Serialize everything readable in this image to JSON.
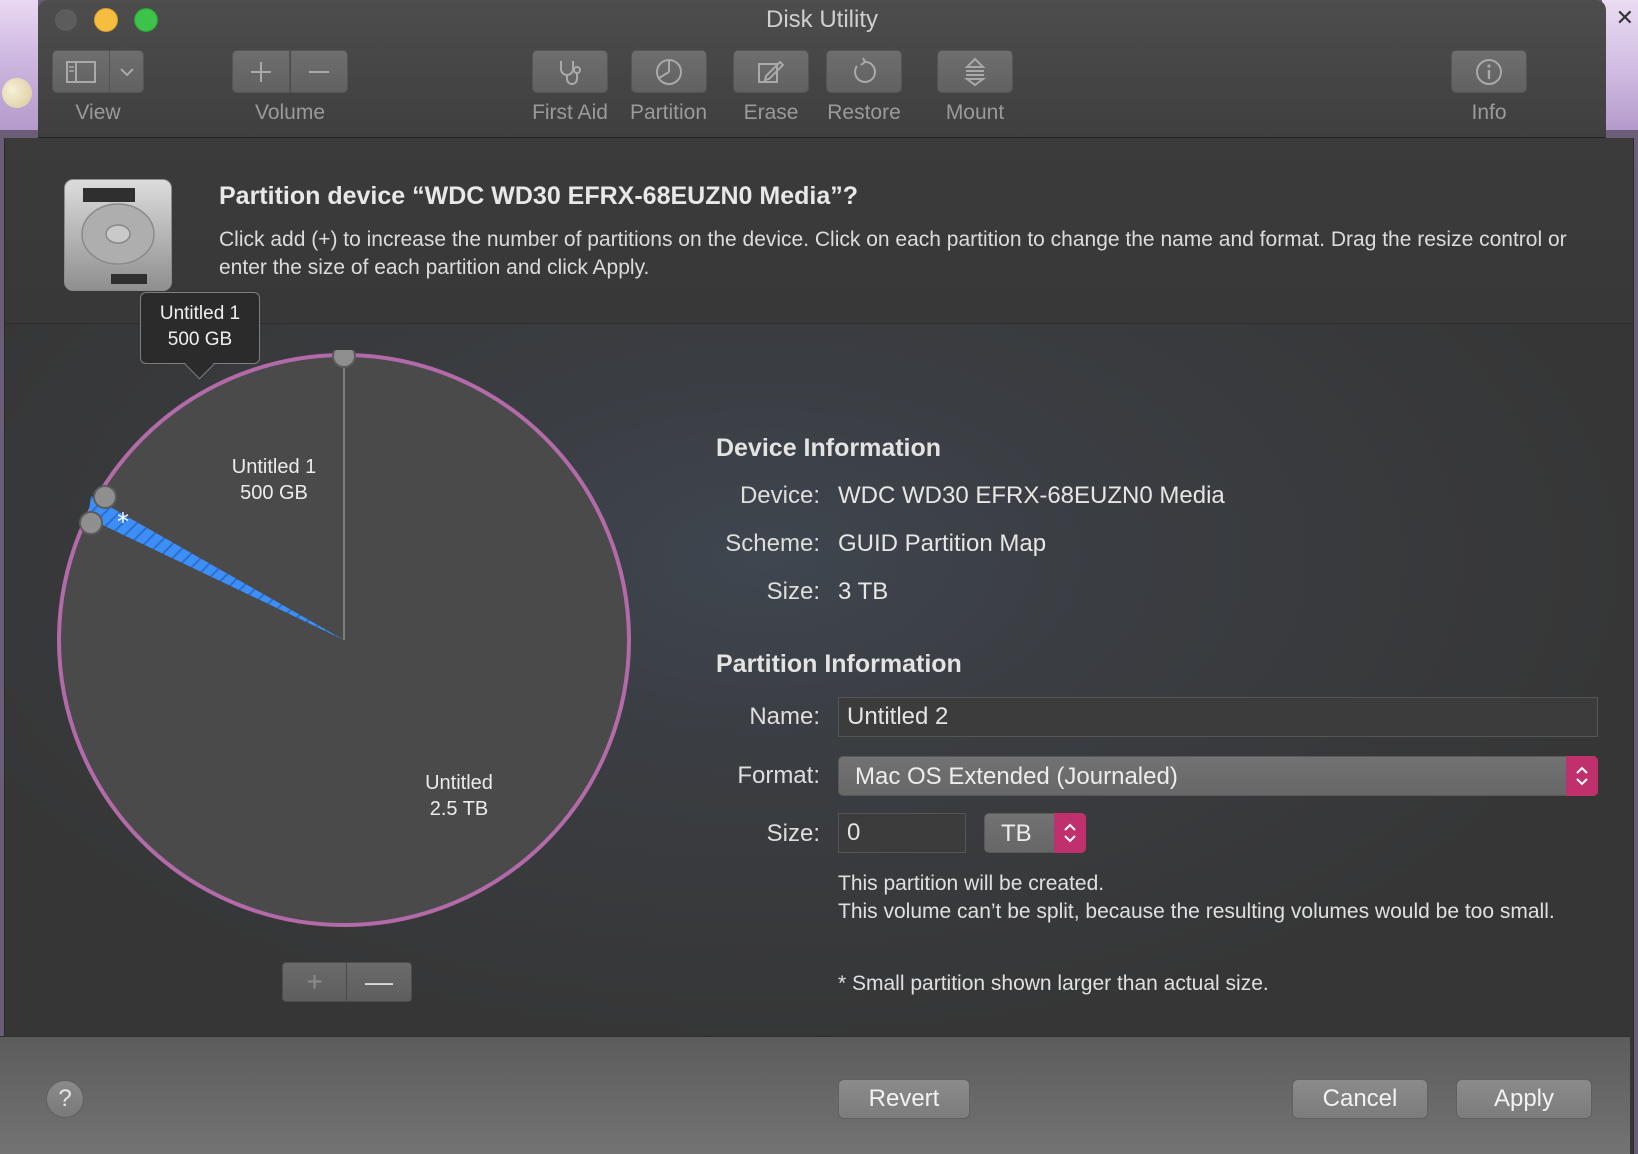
{
  "window": {
    "title": "Disk Utility"
  },
  "toolbar": {
    "view_label": "View",
    "volume_label": "Volume",
    "first_aid_label": "First Aid",
    "partition_label": "Partition",
    "erase_label": "Erase",
    "restore_label": "Restore",
    "mount_label": "Mount",
    "info_label": "Info"
  },
  "sheet": {
    "title": "Partition device “WDC WD30 EFRX-68EUZN0 Media”?",
    "description": "Click add (+) to increase the number of partitions on the device. Click on each partition to change the name and format. Drag the resize control or enter the size of each partition and click Apply."
  },
  "tooltip": {
    "name": "Untitled 1",
    "size": "500 GB"
  },
  "pie": {
    "partitions": [
      {
        "name": "Untitled 1",
        "size": "500 GB",
        "color": "#4a4a4a"
      },
      {
        "name": "Untitled",
        "size": "2.5 TB",
        "color": "#4a4a4a"
      },
      {
        "name": "Untitled 2",
        "size": "0",
        "color": "#3d8ff5",
        "selected": true,
        "marker": "*"
      }
    ],
    "ring_color": "#b36aa8",
    "add_label": "+",
    "remove_label": "—"
  },
  "device_info": {
    "title": "Device Information",
    "device_label": "Device:",
    "device_value": "WDC WD30 EFRX-68EUZN0 Media",
    "scheme_label": "Scheme:",
    "scheme_value": "GUID Partition Map",
    "size_label": "Size:",
    "size_value": "3 TB"
  },
  "partition_info": {
    "title": "Partition Information",
    "name_label": "Name:",
    "name_value": "Untitled 2",
    "format_label": "Format:",
    "format_value": "Mac OS Extended (Journaled)",
    "size_label": "Size:",
    "size_value": "0",
    "unit_value": "TB",
    "note_created": "This partition will be created.",
    "note_split": "This volume can’t be split, because the resulting volumes would be too small.",
    "note_small": "* Small partition shown larger than actual size."
  },
  "footer": {
    "help_label": "?",
    "revert_label": "Revert",
    "cancel_label": "Cancel",
    "apply_label": "Apply"
  },
  "colors": {
    "accent": "#c0306d",
    "selection": "#3d8ff5"
  }
}
